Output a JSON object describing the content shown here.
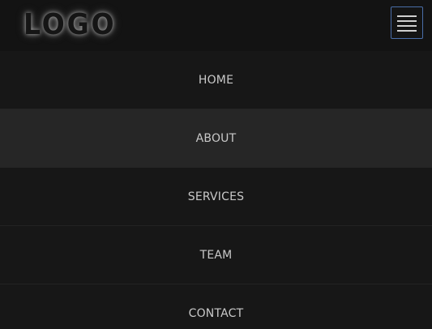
{
  "header": {
    "logo_text": "LOGO",
    "menu_toggle_icon": "hamburger-menu-icon"
  },
  "nav": {
    "items": [
      {
        "label": "HOME",
        "active": false
      },
      {
        "label": "ABOUT",
        "active": true
      },
      {
        "label": "SERVICES",
        "active": false
      },
      {
        "label": "TEAM",
        "active": false
      },
      {
        "label": "CONTACT",
        "active": false
      }
    ]
  },
  "colors": {
    "background": "#171717",
    "navbar": "#131313",
    "active_item": "#262626",
    "text": "#c9c9c9",
    "toggle_border": "#4a6ea8"
  }
}
